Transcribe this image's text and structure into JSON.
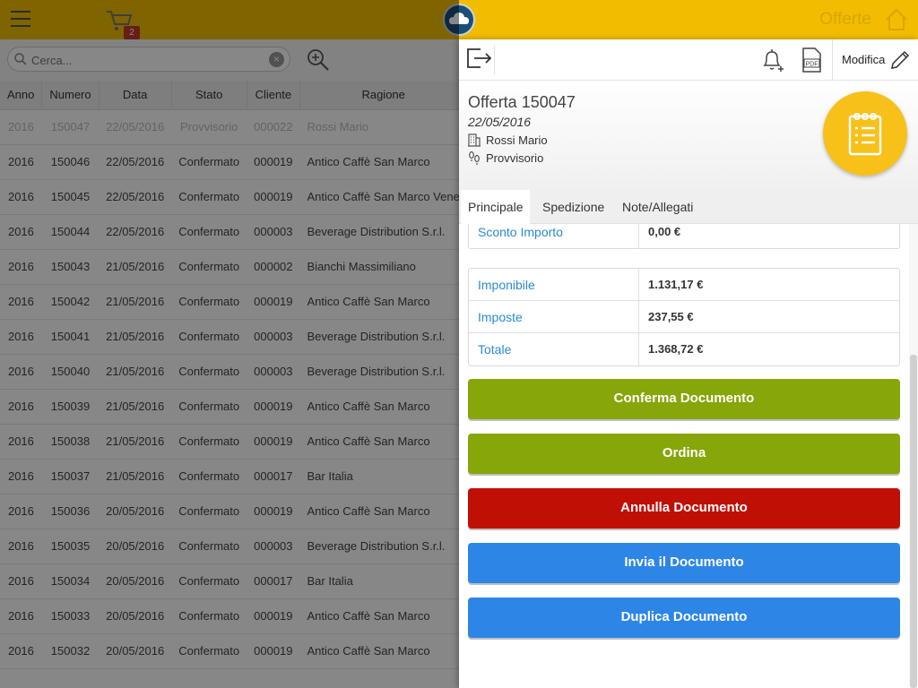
{
  "colors": {
    "topbar": "#f2bd00",
    "green": "#86a60a",
    "red": "#c01005",
    "blue": "#2d86e6",
    "label_blue": "#2a8ad6",
    "doc_circle": "#f7c11a"
  },
  "topbar": {
    "menu_icon": "hamburger-icon",
    "cart_icon": "cart-icon",
    "cart_badge": "2",
    "logo_icon": "cloud-logo-icon",
    "title": "Offerte",
    "home_icon": "home-icon"
  },
  "search": {
    "placeholder": "Cerca...",
    "clear_icon": "clear-icon",
    "zoom_icon": "zoom-icon"
  },
  "table": {
    "columns": [
      "Anno",
      "Numero",
      "Data",
      "Stato",
      "Cliente",
      "Ragione"
    ],
    "rows": [
      [
        "2016",
        "150047",
        "22/05/2016",
        "Provvisorio",
        "000022",
        "Rossi Mario"
      ],
      [
        "2016",
        "150046",
        "22/05/2016",
        "Confermato",
        "000019",
        "Antico Caffè San Marco"
      ],
      [
        "2016",
        "150045",
        "22/05/2016",
        "Confermato",
        "000019",
        "Antico Caffè San Marco Vene"
      ],
      [
        "2016",
        "150044",
        "22/05/2016",
        "Confermato",
        "000003",
        "Beverage Distribution S.r.l."
      ],
      [
        "2016",
        "150043",
        "21/05/2016",
        "Confermato",
        "000002",
        "Bianchi Massimiliano"
      ],
      [
        "2016",
        "150042",
        "21/05/2016",
        "Confermato",
        "000019",
        "Antico Caffè San Marco"
      ],
      [
        "2016",
        "150041",
        "21/05/2016",
        "Confermato",
        "000003",
        "Beverage Distribution S.r.l."
      ],
      [
        "2016",
        "150040",
        "21/05/2016",
        "Confermato",
        "000003",
        "Beverage Distribution S.r.l."
      ],
      [
        "2016",
        "150039",
        "21/05/2016",
        "Confermato",
        "000019",
        "Antico Caffè San Marco"
      ],
      [
        "2016",
        "150038",
        "21/05/2016",
        "Confermato",
        "000019",
        "Antico Caffè San Marco"
      ],
      [
        "2016",
        "150037",
        "21/05/2016",
        "Confermato",
        "000017",
        "Bar Italia"
      ],
      [
        "2016",
        "150036",
        "20/05/2016",
        "Confermato",
        "000019",
        "Antico Caffè San Marco"
      ],
      [
        "2016",
        "150035",
        "20/05/2016",
        "Confermato",
        "000003",
        "Beverage Distribution S.r.l."
      ],
      [
        "2016",
        "150034",
        "20/05/2016",
        "Confermato",
        "000017",
        "Bar Italia"
      ],
      [
        "2016",
        "150033",
        "20/05/2016",
        "Confermato",
        "000019",
        "Antico Caffè San Marco"
      ],
      [
        "2016",
        "150032",
        "20/05/2016",
        "Confermato",
        "000019",
        "Antico Caffè San Marco"
      ]
    ]
  },
  "panel": {
    "toolbar": {
      "exit_icon": "exit-icon",
      "bell_icon": "bell-add-icon",
      "pdf_icon": "pdf-icon",
      "edit_label": "Modifica",
      "edit_icon": "pencil-icon"
    },
    "header": {
      "title": "Offerta 150047",
      "date": "22/05/2016",
      "client": "Rossi Mario",
      "status": "Provvisorio",
      "doc_icon": "document-list-icon"
    },
    "tabs": [
      "Principale",
      "Spedizione",
      "Note/Allegati"
    ],
    "fields_top": [
      {
        "label": "Sconto Importo",
        "value": "0,00 €"
      }
    ],
    "totals": [
      {
        "label": "Imponibile",
        "value": "1.131,17 €"
      },
      {
        "label": "Imposte",
        "value": "237,55 €"
      },
      {
        "label": "Totale",
        "value": "1.368,72 €"
      }
    ],
    "buttons": {
      "confirm": "Conferma Documento",
      "order": "Ordina",
      "cancel": "Annulla Documento",
      "send": "Invia il Documento",
      "duplicate": "Duplica Documento"
    }
  }
}
